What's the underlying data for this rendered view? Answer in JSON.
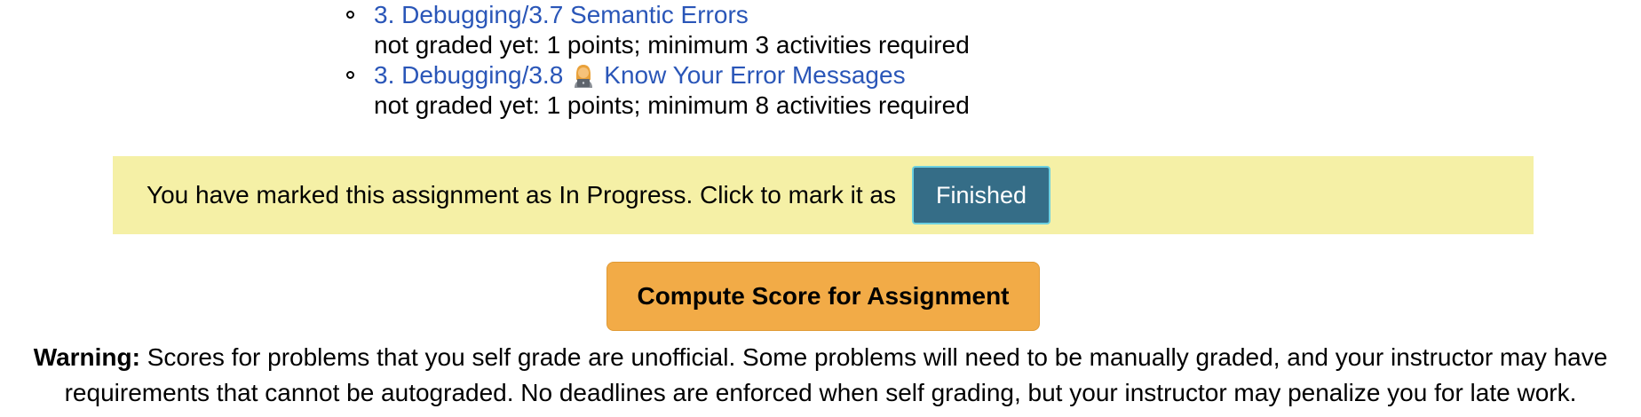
{
  "activities": [
    {
      "link": "3. Debugging/3.7 Semantic Errors",
      "note": "not graded yet: 1 points; minimum 3 activities required"
    },
    {
      "link_prefix": "3. Debugging/3.8",
      "icon": "person-with-laptop-icon",
      "link_suffix": "Know Your Error Messages",
      "note": "not graded yet: 1 points; minimum 8 activities required"
    }
  ],
  "status": {
    "message": "You have marked this assignment as In Progress. Click to mark it as",
    "button_label": "Finished"
  },
  "compute_button_label": "Compute Score for Assignment",
  "warning": {
    "label": "Warning:",
    "text": " Scores for problems that you self grade are unofficial. Some problems will need to be manually graded, and your instructor may have requirements that cannot be autograded. No deadlines are enforced when self grading, but your instructor may penalize you for late work."
  },
  "colors": {
    "link": "#2a56b8",
    "status_bg": "#f5f0a6",
    "finished_bg": "#356d87",
    "compute_bg": "#f2ab47"
  }
}
